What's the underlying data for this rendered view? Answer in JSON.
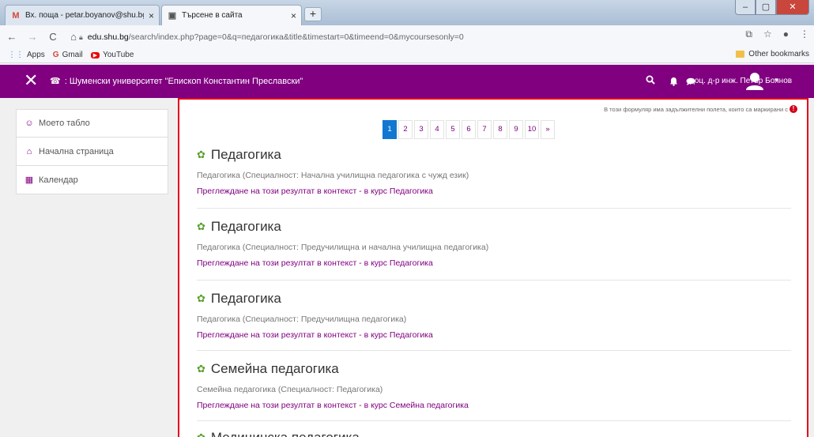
{
  "browser": {
    "tabs": [
      {
        "icon": "M",
        "title": "Вх. поща - petar.boyanov@shu.bg",
        "close": "×"
      },
      {
        "icon": "▣",
        "title": "Търсене в сайта",
        "close": "×"
      }
    ],
    "new_tab": "+",
    "window_buttons": {
      "min": "–",
      "max": "▢",
      "close": "✕"
    },
    "url_host": "edu.shu.bg",
    "url_path": "/search/index.php?page=0&q=педагогика&title&timestart=0&timeend=0&mycoursesonly=0",
    "bookmarks": [
      {
        "icon": "⋮⋮",
        "label": "Apps"
      },
      {
        "icon": "G",
        "label": "Gmail"
      },
      {
        "icon": "▶",
        "label": "YouTube"
      }
    ],
    "other_bookmarks": "Other bookmarks"
  },
  "navbar": {
    "close_glyph": "✕",
    "phone_glyph": "☎",
    "university": ": Шуменски университет \"Епископ Константин Преславски\"",
    "user_name": "доц. д-р инж. Петър Боянов",
    "caret": "▾"
  },
  "sidebar": {
    "items": [
      {
        "icon": "☺",
        "label": "Моето табло"
      },
      {
        "icon": "⌂",
        "label": "Начална страница"
      },
      {
        "icon": "▦",
        "label": "Календар"
      }
    ]
  },
  "main": {
    "notice": "В този формуляр има задължителни полета, които са маркирани с",
    "notice_mark": "!",
    "pagination": [
      "1",
      "2",
      "3",
      "4",
      "5",
      "6",
      "7",
      "8",
      "9",
      "10",
      "»"
    ],
    "active_page": "1",
    "results": [
      {
        "title": "Педагогика",
        "description": "Педагогика (Специалност: Начална училищна педагогика с чужд език)",
        "link": "Преглеждане на този резултат в контекст - в курс Педагогика"
      },
      {
        "title": "Педагогика",
        "description": "Педагогика (Специалност: Предучилищна и начална училищна педагогика)",
        "link": "Преглеждане на този резултат в контекст - в курс Педагогика"
      },
      {
        "title": "Педагогика",
        "description": "Педагогика (Специалност: Предучилищна педагогика)",
        "link": "Преглеждане на този резултат в контекст - в курс Педагогика"
      },
      {
        "title": "Семейна педагогика",
        "description": "Семейна педагогика (Специалност: Педагогика)",
        "link": "Преглеждане на този резултат в контекст - в курс Семейна педагогика"
      },
      {
        "title": "Медицинска педагогика",
        "description": "",
        "link": ""
      }
    ]
  },
  "colors": {
    "brand": "#800080",
    "accent_blue": "#1177d1",
    "highlight_border": "#e3001b",
    "result_icon": "#5aa02c"
  }
}
